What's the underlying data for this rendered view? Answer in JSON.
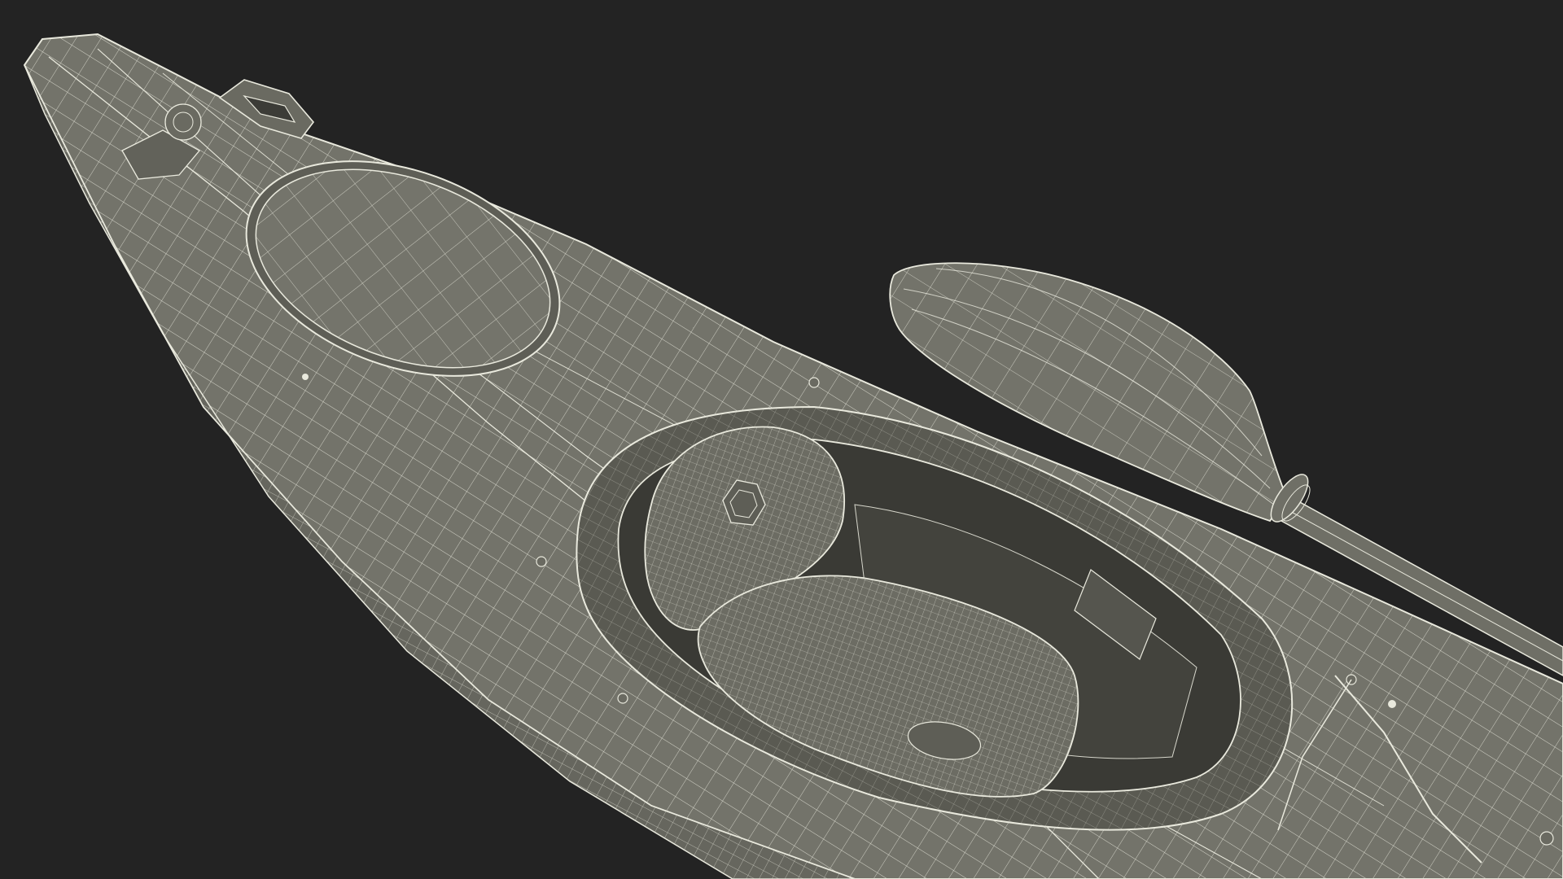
{
  "scene": {
    "subject": "kayak-wireframe-render",
    "colors": {
      "background": "#232323",
      "hull": "#73736a",
      "hull_light": "#7d7d73",
      "hull_dark": "#5e5e56",
      "cockpit_inner": "#4a4a44",
      "cockpit_deep": "#3a3a35",
      "wire": "#e9e9dd",
      "seat": "#6c6c63"
    }
  }
}
